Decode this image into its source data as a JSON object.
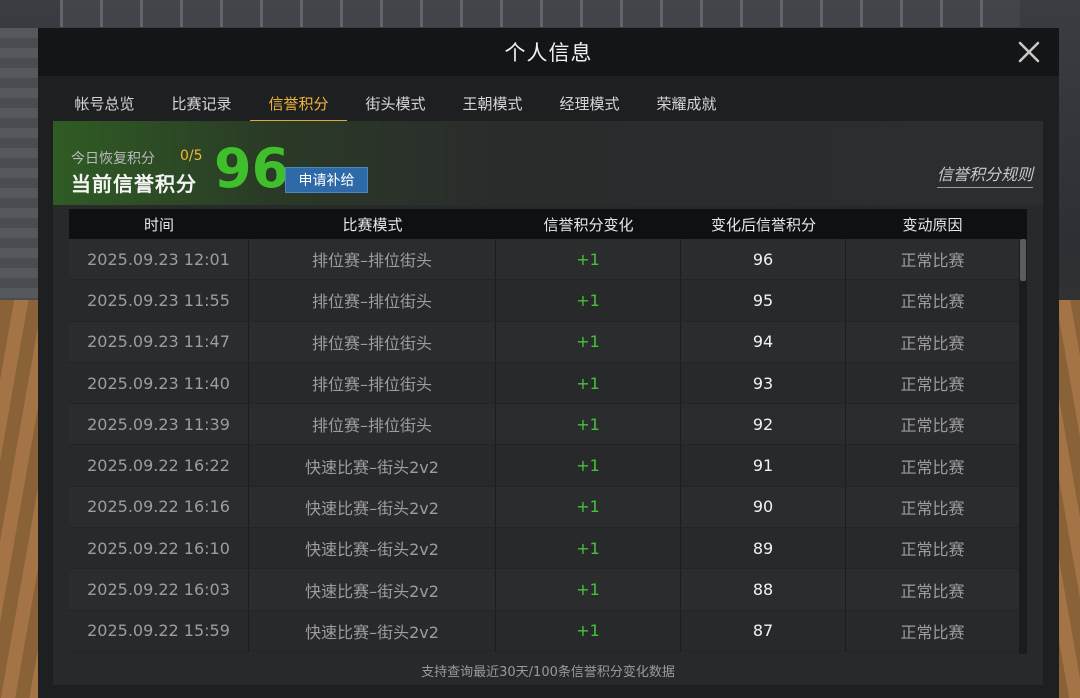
{
  "dialog": {
    "title": "个人信息"
  },
  "tabs": [
    {
      "label": "帐号总览",
      "active": false
    },
    {
      "label": "比赛记录",
      "active": false
    },
    {
      "label": "信誉积分",
      "active": true
    },
    {
      "label": "街头模式",
      "active": false
    },
    {
      "label": "王朝模式",
      "active": false
    },
    {
      "label": "经理模式",
      "active": false
    },
    {
      "label": "荣耀成就",
      "active": false
    }
  ],
  "summary": {
    "today_label": "今日恢复积分",
    "today_count": "0/5",
    "current_label": "当前信誉积分",
    "score": "96",
    "apply_button": "申请补给",
    "rules_link": "信誉积分规则"
  },
  "table": {
    "headers": [
      "时间",
      "比赛模式",
      "信誉积分变化",
      "变化后信誉积分",
      "变动原因"
    ],
    "rows": [
      {
        "time": "2025.09.23  12:01",
        "mode": "排位赛–排位街头",
        "change": "+1",
        "after": "96",
        "reason": "正常比赛"
      },
      {
        "time": "2025.09.23  11:55",
        "mode": "排位赛–排位街头",
        "change": "+1",
        "after": "95",
        "reason": "正常比赛"
      },
      {
        "time": "2025.09.23  11:47",
        "mode": "排位赛–排位街头",
        "change": "+1",
        "after": "94",
        "reason": "正常比赛"
      },
      {
        "time": "2025.09.23  11:40",
        "mode": "排位赛–排位街头",
        "change": "+1",
        "after": "93",
        "reason": "正常比赛"
      },
      {
        "time": "2025.09.23  11:39",
        "mode": "排位赛–排位街头",
        "change": "+1",
        "after": "92",
        "reason": "正常比赛"
      },
      {
        "time": "2025.09.22  16:22",
        "mode": "快速比赛–街头2v2",
        "change": "+1",
        "after": "91",
        "reason": "正常比赛"
      },
      {
        "time": "2025.09.22  16:16",
        "mode": "快速比赛–街头2v2",
        "change": "+1",
        "after": "90",
        "reason": "正常比赛"
      },
      {
        "time": "2025.09.22  16:10",
        "mode": "快速比赛–街头2v2",
        "change": "+1",
        "after": "89",
        "reason": "正常比赛"
      },
      {
        "time": "2025.09.22  16:03",
        "mode": "快速比赛–街头2v2",
        "change": "+1",
        "after": "88",
        "reason": "正常比赛"
      },
      {
        "time": "2025.09.22  15:59",
        "mode": "快速比赛–街头2v2",
        "change": "+1",
        "after": "87",
        "reason": "正常比赛"
      }
    ]
  },
  "footer_note": "支持查询最近30天/100条信誉积分变化数据",
  "colors": {
    "accent": "#f0b53a",
    "score_green": "#3fbf2c",
    "change_green": "#45c23a",
    "button_blue": "#2e6aa8"
  },
  "icons": {
    "close": "close-icon"
  }
}
